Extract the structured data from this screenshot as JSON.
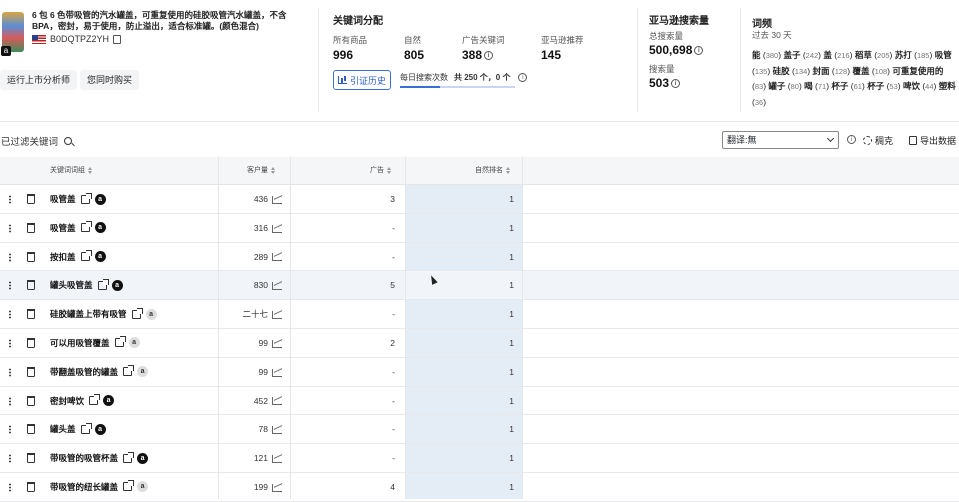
{
  "product": {
    "title": "6 包 6 色带吸管的汽水罐盖，可重复使用的硅胶吸管汽水罐盖，不含 BPA，密封，易于使用，防止溢出，适合标准罐。(颜色混合)",
    "asin": "B0DQTPZ2YH",
    "buttons": [
      "运行上市分析师",
      "您同时购买"
    ],
    "badge": "a"
  },
  "keyword_distribution": {
    "title": "关键词分配",
    "metrics": [
      {
        "label": "所有商品",
        "value": "996"
      },
      {
        "label": "自然",
        "value": "805"
      },
      {
        "label": "广告关键词",
        "value": "388"
      },
      {
        "label": "亚马逊推荐",
        "value": "145"
      }
    ],
    "history_button": "引证历史",
    "daily_label": "每日搜索次数",
    "daily_value": "共 250 个，0 个"
  },
  "amazon_search": {
    "title": "亚马逊搜索量",
    "total_label": "总搜索量",
    "total_value": "500,698",
    "search_label": "搜索量",
    "search_value": "503"
  },
  "word_freq": {
    "title": "词频",
    "period": "过去 30 天",
    "words": [
      {
        "w": "能",
        "c": "380"
      },
      {
        "w": "盖子",
        "c": "242"
      },
      {
        "w": "盖",
        "c": "216"
      },
      {
        "w": "稻草",
        "c": "205"
      },
      {
        "w": "苏打",
        "c": "185"
      },
      {
        "w": "吸管",
        "c": "135"
      },
      {
        "w": "硅胶",
        "c": "134"
      },
      {
        "w": "封面",
        "c": "128"
      },
      {
        "w": "覆盖",
        "c": "108"
      },
      {
        "w": "可重复使用的",
        "c": "83"
      },
      {
        "w": "罐子",
        "c": "80"
      },
      {
        "w": "喝",
        "c": "71"
      },
      {
        "w": "杯子",
        "c": "61"
      },
      {
        "w": "杯子",
        "c": "53"
      },
      {
        "w": "啤饮",
        "c": "44"
      },
      {
        "w": "塑料",
        "c": "36"
      }
    ]
  },
  "toolbar": {
    "filter_label": "已过滤关键词",
    "translate_value": "翻译:無",
    "density_label": "稠克",
    "export_label": "导出数据"
  },
  "table": {
    "headers": {
      "keyword": "关键词词组",
      "search_volume": "客户量",
      "ads": "广告",
      "organic_rank": "自然排名"
    },
    "rows": [
      {
        "keyword": "吸管盖",
        "volume": "436",
        "ads": "3",
        "rank": "1",
        "amz": "dark"
      },
      {
        "keyword": "吸管盖",
        "volume": "316",
        "ads": "-",
        "rank": "1",
        "amz": "dark"
      },
      {
        "keyword": "按扣盖",
        "volume": "289",
        "ads": "-",
        "rank": "1",
        "amz": "dark"
      },
      {
        "keyword": "罐头吸管盖",
        "volume": "830",
        "ads": "5",
        "rank": "1",
        "amz": "dark"
      },
      {
        "keyword": "硅胶罐盖上带有吸管",
        "volume": "二十七",
        "ads": "-",
        "rank": "1",
        "amz": "lite"
      },
      {
        "keyword": "可以用吸管覆盖",
        "volume": "99",
        "ads": "2",
        "rank": "1",
        "amz": "lite"
      },
      {
        "keyword": "带翻盖吸管的罐盖",
        "volume": "99",
        "ads": "-",
        "rank": "1",
        "amz": "lite"
      },
      {
        "keyword": "密封啤饮",
        "volume": "452",
        "ads": "-",
        "rank": "1",
        "amz": "dark"
      },
      {
        "keyword": "罐头盖",
        "volume": "78",
        "ads": "-",
        "rank": "1",
        "amz": "dark"
      },
      {
        "keyword": "带吸管的吸管杯盖",
        "volume": "121",
        "ads": "-",
        "rank": "1",
        "amz": "dark"
      },
      {
        "keyword": "带吸管的纽长罐盖",
        "volume": "199",
        "ads": "4",
        "rank": "1",
        "amz": "lite"
      }
    ]
  }
}
